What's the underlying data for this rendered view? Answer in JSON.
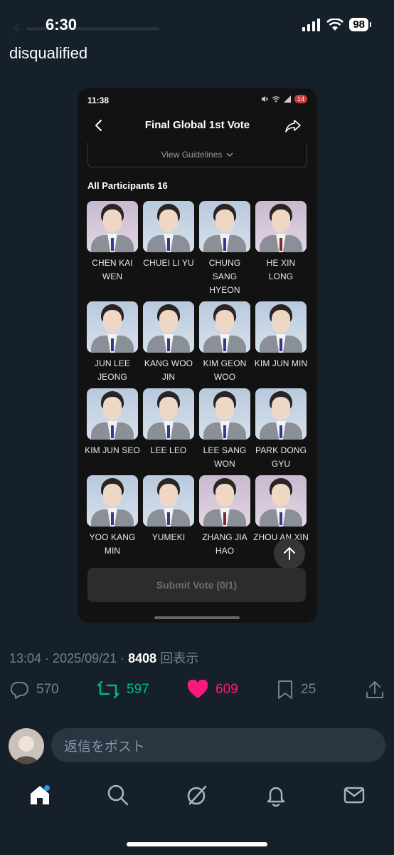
{
  "status": {
    "time": "6:30",
    "battery": "98"
  },
  "post": {
    "text": "disqualified"
  },
  "embedded": {
    "status_time": "11:38",
    "status_badge": "14",
    "title": "Final Global 1st Vote",
    "guidelines": "View Guidelines",
    "participants_label": "All Participants 16",
    "participants": [
      {
        "name": "CHEN KAI WEN",
        "tone": "pink",
        "tie": "blue"
      },
      {
        "name": "CHUEI LI YU",
        "tone": "blue",
        "tie": "blue"
      },
      {
        "name": "CHUNG SANG HYEON",
        "tone": "blue",
        "tie": "blue"
      },
      {
        "name": "HE XIN LONG",
        "tone": "pink",
        "tie": "red"
      },
      {
        "name": "JUN LEE JEONG",
        "tone": "blue",
        "tie": "blue"
      },
      {
        "name": "KANG WOO JIN",
        "tone": "blue",
        "tie": "blue"
      },
      {
        "name": "KIM GEON WOO",
        "tone": "blue",
        "tie": "blue"
      },
      {
        "name": "KIM JUN MIN",
        "tone": "blue",
        "tie": "blue"
      },
      {
        "name": "KIM JUN SEO",
        "tone": "blue",
        "tie": "blue"
      },
      {
        "name": "LEE LEO",
        "tone": "blue",
        "tie": "blue"
      },
      {
        "name": "LEE SANG WON",
        "tone": "blue",
        "tie": "blue"
      },
      {
        "name": "PARK DONG GYU",
        "tone": "blue",
        "tie": "blue"
      },
      {
        "name": "YOO KANG MIN",
        "tone": "blue",
        "tie": "blue"
      },
      {
        "name": "YUMEKI",
        "tone": "blue",
        "tie": "blue"
      },
      {
        "name": "ZHANG JIA HAO",
        "tone": "pink",
        "tie": "red"
      },
      {
        "name": "ZHOU AN XIN",
        "tone": "pink",
        "tie": "blue"
      }
    ],
    "submit_label": "Submit Vote (0/1)"
  },
  "meta": {
    "time": "13:04",
    "date": "2025/09/21",
    "views": "8408",
    "views_label": "回表示"
  },
  "actions": {
    "replies": "570",
    "retweets": "597",
    "likes": "609",
    "bookmarks": "25"
  },
  "colors": {
    "retweet": "#00ba7c",
    "like": "#f91880",
    "muted": "#71808f"
  },
  "reply": {
    "placeholder": "返信をポスト"
  },
  "tabs": [
    "home-icon",
    "search-icon",
    "grok-icon",
    "notifications-icon",
    "messages-icon"
  ]
}
